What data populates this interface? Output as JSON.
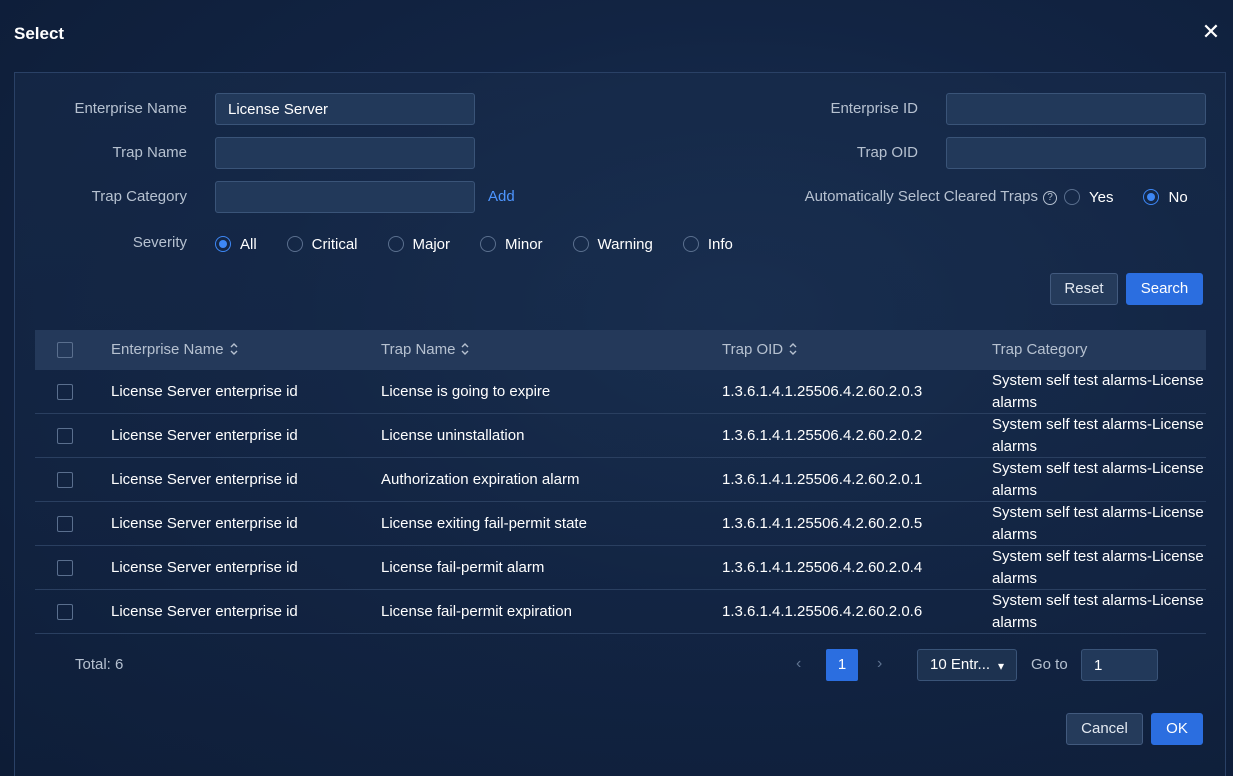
{
  "dialog": {
    "title": "Select"
  },
  "form": {
    "enterprise_name_label": "Enterprise Name",
    "enterprise_name_value": "License Server",
    "enterprise_id_label": "Enterprise ID",
    "enterprise_id_value": "",
    "trap_name_label": "Trap Name",
    "trap_name_value": "",
    "trap_oid_label": "Trap OID",
    "trap_oid_value": "",
    "trap_category_label": "Trap Category",
    "trap_category_value": "",
    "add_link": "Add",
    "auto_select_label": "Automatically Select Cleared Traps",
    "auto_select_options": [
      "Yes",
      "No"
    ],
    "auto_select_selected": "No",
    "severity_label": "Severity",
    "severity_options": [
      "All",
      "Critical",
      "Major",
      "Minor",
      "Warning",
      "Info"
    ],
    "severity_selected": "All",
    "reset_button": "Reset",
    "search_button": "Search"
  },
  "table": {
    "columns": [
      "Enterprise Name",
      "Trap Name",
      "Trap OID",
      "Trap Category"
    ],
    "rows": [
      [
        "License Server enterprise id",
        "License is going to expire",
        "1.3.6.1.4.1.25506.4.2.60.2.0.3",
        "System self test alarms-License alarms"
      ],
      [
        "License Server enterprise id",
        "License uninstallation",
        "1.3.6.1.4.1.25506.4.2.60.2.0.2",
        "System self test alarms-License alarms"
      ],
      [
        "License Server enterprise id",
        "Authorization expiration alarm",
        "1.3.6.1.4.1.25506.4.2.60.2.0.1",
        "System self test alarms-License alarms"
      ],
      [
        "License Server enterprise id",
        "License exiting fail-permit state",
        "1.3.6.1.4.1.25506.4.2.60.2.0.5",
        "System self test alarms-License alarms"
      ],
      [
        "License Server enterprise id",
        "License fail-permit alarm",
        "1.3.6.1.4.1.25506.4.2.60.2.0.4",
        "System self test alarms-License alarms"
      ],
      [
        "License Server enterprise id",
        "License fail-permit expiration",
        "1.3.6.1.4.1.25506.4.2.60.2.0.6",
        "System self test alarms-License alarms"
      ]
    ]
  },
  "pagination": {
    "total": "Total: 6",
    "current_page": "1",
    "page_size": "10 Entr...",
    "goto_label": "Go to",
    "goto_value": "1"
  },
  "actions": {
    "cancel": "Cancel",
    "ok": "OK"
  },
  "colors": {
    "accent": "#2b6ee0",
    "link": "#4d95ff",
    "background": "#122443"
  }
}
